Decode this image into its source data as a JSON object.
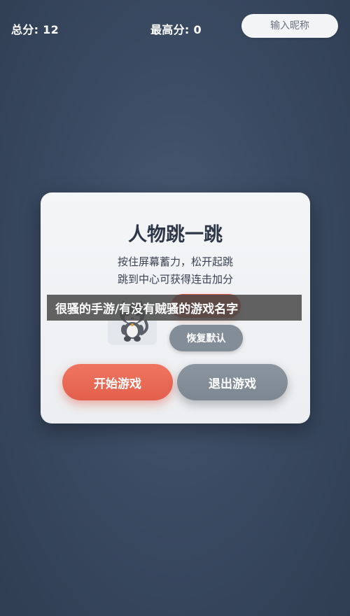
{
  "header": {
    "total_score_label": "总分: 12",
    "best_score_label": "最高分: 0",
    "nickname_placeholder": "输入昵称"
  },
  "dialog": {
    "title": "人物跳一跳",
    "description_line1": "按住屏幕蓄力，松开起跳",
    "description_line2": "跳到中心可获得连击加分",
    "avatar_icon": "cat-character-icon",
    "reset_label": "恢复默认",
    "start_label": "开始游戏",
    "exit_label": "退出游戏"
  },
  "caption": {
    "text": "很骚的手游/有没有贼骚的游戏名字"
  },
  "colors": {
    "background": "#3b4b63",
    "accent": "#e2604c",
    "secondary": "#838d97",
    "dialog_bg": "#f4f5f7"
  }
}
